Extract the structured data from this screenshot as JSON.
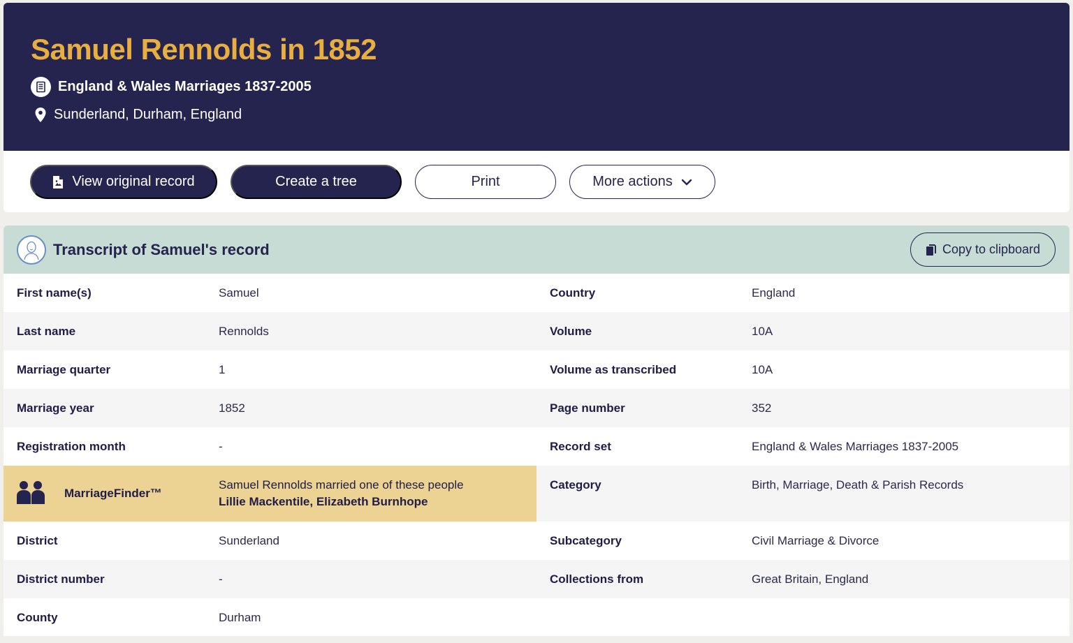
{
  "header": {
    "title": "Samuel Rennolds in 1852",
    "collection": "England & Wales Marriages 1837-2005",
    "location": "Sunderland, Durham, England"
  },
  "actions": {
    "view_original": "View original record",
    "create_tree": "Create a tree",
    "print": "Print",
    "more_actions": "More actions"
  },
  "transcript": {
    "title": "Transcript of Samuel's record",
    "copy_label": "Copy to clipboard",
    "left": [
      {
        "label": "First name(s)",
        "value": "Samuel"
      },
      {
        "label": "Last name",
        "value": "Rennolds"
      },
      {
        "label": "Marriage quarter",
        "value": "1"
      },
      {
        "label": "Marriage year",
        "value": "1852"
      },
      {
        "label": "Registration month",
        "value": "-"
      },
      {
        "label": "District",
        "value": "Sunderland"
      },
      {
        "label": "District number",
        "value": "-"
      },
      {
        "label": "County",
        "value": "Durham"
      }
    ],
    "right": [
      {
        "label": "Country",
        "value": "England"
      },
      {
        "label": "Volume",
        "value": "10A"
      },
      {
        "label": "Volume as transcribed",
        "value": "10A"
      },
      {
        "label": "Page number",
        "value": "352"
      },
      {
        "label": "Record set",
        "value": "England & Wales Marriages 1837-2005"
      },
      {
        "label": "Category",
        "value": "Birth, Marriage, Death & Parish Records"
      },
      {
        "label": "Subcategory",
        "value": "Civil Marriage & Divorce"
      },
      {
        "label": "Collections from",
        "value": "Great Britain, England"
      }
    ],
    "marriage_finder": {
      "label": "MarriageFinder™",
      "text": "Samuel Rennolds married one of these people",
      "names": "Lillie Mackentile, Elizabeth Burnhope"
    }
  },
  "colors": {
    "navy": "#25244f",
    "gold": "#e8ae3f",
    "teal_header": "#c6dcd4",
    "finder_bg": "#ecd393"
  }
}
